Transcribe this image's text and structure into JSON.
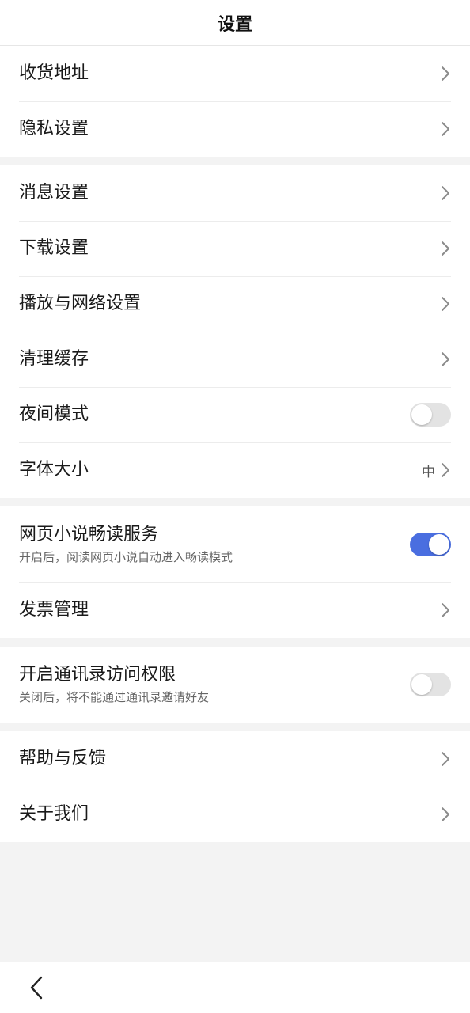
{
  "header": {
    "title": "设置"
  },
  "groups": [
    {
      "rows": [
        {
          "label": "收货地址",
          "control": "chevron"
        },
        {
          "label": "隐私设置",
          "control": "chevron"
        }
      ]
    },
    {
      "rows": [
        {
          "label": "消息设置",
          "control": "chevron"
        },
        {
          "label": "下载设置",
          "control": "chevron"
        },
        {
          "label": "播放与网络设置",
          "control": "chevron"
        },
        {
          "label": "清理缓存",
          "control": "chevron"
        },
        {
          "label": "夜间模式",
          "control": "toggle",
          "on": false
        },
        {
          "label": "字体大小",
          "control": "chevron",
          "value": "中"
        }
      ]
    },
    {
      "rows": [
        {
          "label": "网页小说畅读服务",
          "sub": "开启后，阅读网页小说自动进入畅读模式",
          "control": "toggle",
          "on": true
        },
        {
          "label": "发票管理",
          "control": "chevron"
        }
      ]
    },
    {
      "rows": [
        {
          "label": "开启通讯录访问权限",
          "sub": "关闭后，将不能通过通讯录邀请好友",
          "control": "toggle",
          "on": false
        }
      ]
    },
    {
      "rows": [
        {
          "label": "帮助与反馈",
          "control": "chevron"
        },
        {
          "label": "关于我们",
          "control": "chevron"
        }
      ]
    }
  ],
  "colors": {
    "accent": "#4a6ee0",
    "background": "#f3f3f3",
    "toggle_off": "#e3e3e3"
  },
  "bottom_bar": {
    "back_icon": "chevron-left-icon"
  }
}
